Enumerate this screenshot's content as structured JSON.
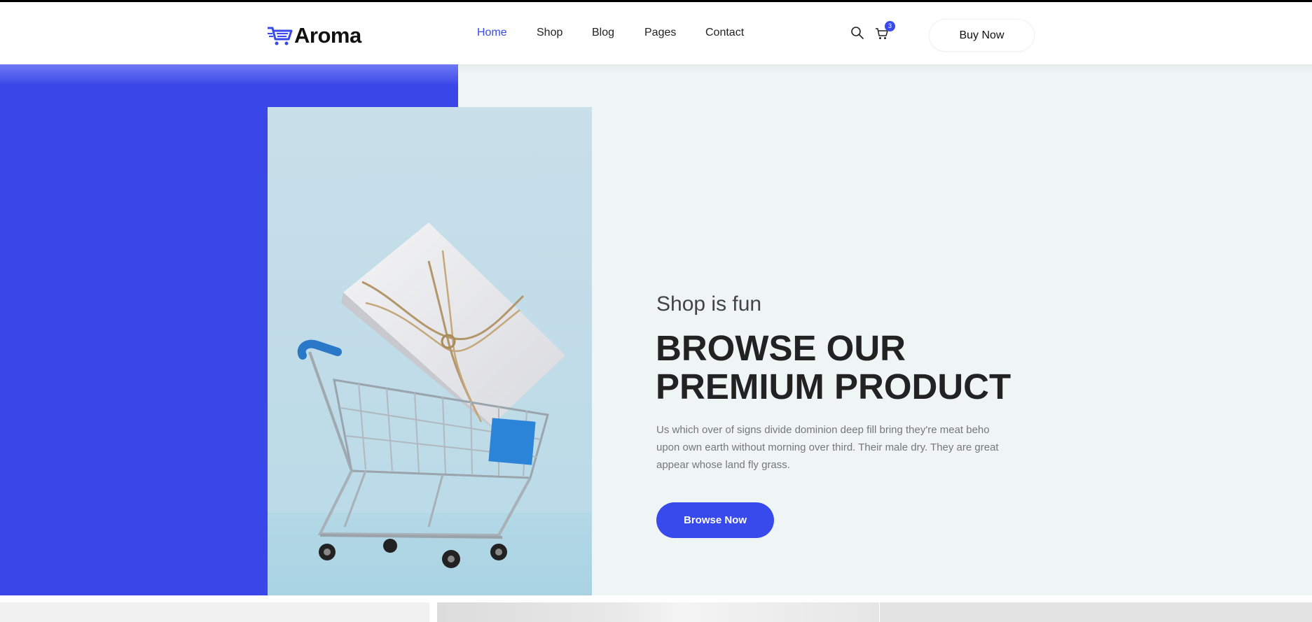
{
  "header": {
    "logo_text": "Aroma",
    "nav": [
      {
        "label": "Home",
        "active": true
      },
      {
        "label": "Shop",
        "active": false
      },
      {
        "label": "Blog",
        "active": false
      },
      {
        "label": "Pages",
        "active": false
      },
      {
        "label": "Contact",
        "active": false
      }
    ],
    "icons": [
      "search-icon",
      "cart-icon"
    ],
    "cart_count": "3",
    "buy_label": "Buy Now"
  },
  "hero": {
    "subtitle": "Shop is fun",
    "title_line1": "BROWSE OUR",
    "title_line2": "PREMIUM PRODUCT",
    "description": "Us which over of signs divide dominion deep fill bring they're meat beho upon own earth without morning over third. Their male dry. They are great appear whose land fly grass.",
    "button_label": "Browse Now"
  },
  "colors": {
    "accent": "#384aeb",
    "hero_bg": "#eff5f5",
    "heading": "#222222",
    "body_text": "#777777"
  }
}
